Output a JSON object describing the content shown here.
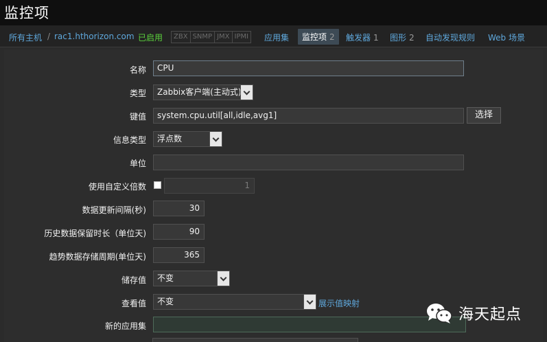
{
  "page": {
    "title": "监控项"
  },
  "nav": {
    "all_hosts": "所有主机",
    "sep": "/",
    "host": "rac1.hthorizon.com",
    "status": "已启用",
    "badges": [
      "ZBX",
      "SNMP",
      "JMX",
      "IPMI"
    ],
    "applications": "应用集",
    "items": {
      "label": "监控项",
      "count": "2"
    },
    "triggers": {
      "label": "触发器",
      "count": "1"
    },
    "graphs": {
      "label": "图形",
      "count": "2"
    },
    "discovery": "自动发现规则",
    "web": "Web 场景"
  },
  "form": {
    "name": {
      "label": "名称",
      "value": "CPU"
    },
    "type": {
      "label": "类型",
      "value": "Zabbix客户端(主动式)"
    },
    "key": {
      "label": "键值",
      "value": "system.cpu.util[all,idle,avg1]",
      "button": "选择"
    },
    "info_type": {
      "label": "信息类型",
      "value": "浮点数"
    },
    "units": {
      "label": "单位",
      "value": ""
    },
    "multiplier": {
      "label": "使用自定义倍数",
      "value": "1"
    },
    "interval": {
      "label": "数据更新间隔(秒)",
      "value": "30"
    },
    "history": {
      "label": "历史数据保留时长（单位天)",
      "value": "90"
    },
    "trends": {
      "label": "趋势数据存储周期(单位天)",
      "value": "365"
    },
    "store_value": {
      "label": "储存值",
      "value": "不变"
    },
    "show_value": {
      "label": "查看值",
      "value": "不变",
      "link": "展示值映射"
    },
    "new_app": {
      "label": "新的应用集",
      "value": ""
    }
  },
  "watermark": {
    "text": "海天起点"
  }
}
